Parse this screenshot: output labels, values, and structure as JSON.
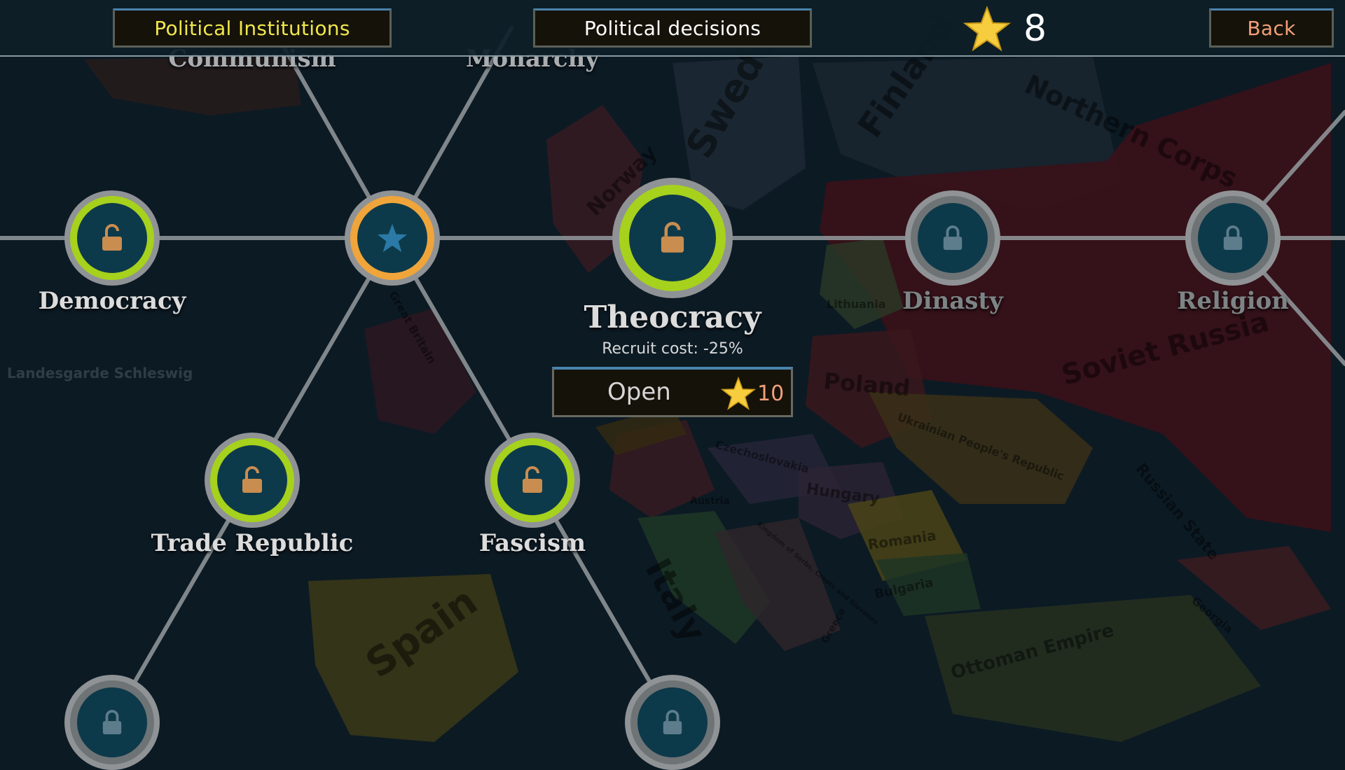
{
  "topbar": {
    "tab_institutions": "Political Institutions",
    "tab_decisions": "Political decisions",
    "stars": "8",
    "back_label": "Back"
  },
  "nodes": {
    "communism": "Communism",
    "monarchy": "Monarchy",
    "democracy": "Democracy",
    "theocracy": "Theocracy",
    "dinasty": "Dinasty",
    "religion": "Religion",
    "trade_republic": "Trade Republic",
    "fascism": "Fascism"
  },
  "selected": {
    "name": "Theocracy",
    "effect": "Recruit cost: -25%",
    "open_label": "Open",
    "cost": "10"
  },
  "map_labels": {
    "sweden": "Sweden",
    "finland": "Finland",
    "northern_corps": "Northern Corps",
    "norway": "Norway",
    "lithuania": "Lithuania",
    "poland": "Poland",
    "soviet_russia": "Soviet Russia",
    "great_britain": "Great Britain",
    "ukrainian_peoples_republic": "Ukrainian People's Republic",
    "czechoslovakia": "Czechoslovakia",
    "austria": "Austria",
    "hungary": "Hungary",
    "russian_state": "Russian State",
    "romania": "Romania",
    "bulgaria": "Bulgaria",
    "italy": "Italy",
    "spain": "Spain",
    "ottoman_empire": "Ottoman Empire",
    "georgia": "Georgia",
    "greece": "Greece",
    "yugoslavia": "Kingdom of Serbs, Croats and Slovenes",
    "schleswig": "Landesgarde Schleswig"
  },
  "colors": {
    "ring_available": "#a6d11d",
    "ring_active": "#f0a53a",
    "ring_locked": "#8f9396",
    "node_core": "#0d3a4a",
    "lock_open": "#c98d50",
    "lock_closed": "#5d7d8c",
    "tab_highlight": "#f0e74c",
    "back_text": "#f2a07a"
  },
  "icons": {
    "stars": "star-icon",
    "unlocked": "open-padlock-icon",
    "locked": "closed-padlock-icon",
    "active": "star-icon"
  }
}
